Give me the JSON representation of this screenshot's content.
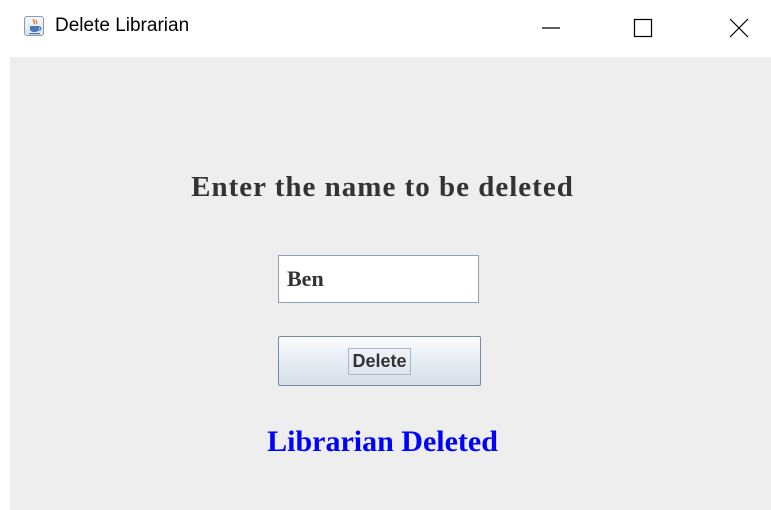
{
  "window": {
    "title": "Delete Librarian",
    "icons": {
      "app": "java-cup-icon",
      "minimize": "minimize-icon",
      "maximize": "maximize-icon",
      "close": "close-icon"
    }
  },
  "form": {
    "heading": "Enter the name to be deleted",
    "name_value": "Ben",
    "delete_label": "Delete",
    "status_message": "Librarian Deleted"
  },
  "colors": {
    "content_background": "#eeeeee",
    "heading": "#333333",
    "status_message": "#0000ff"
  }
}
